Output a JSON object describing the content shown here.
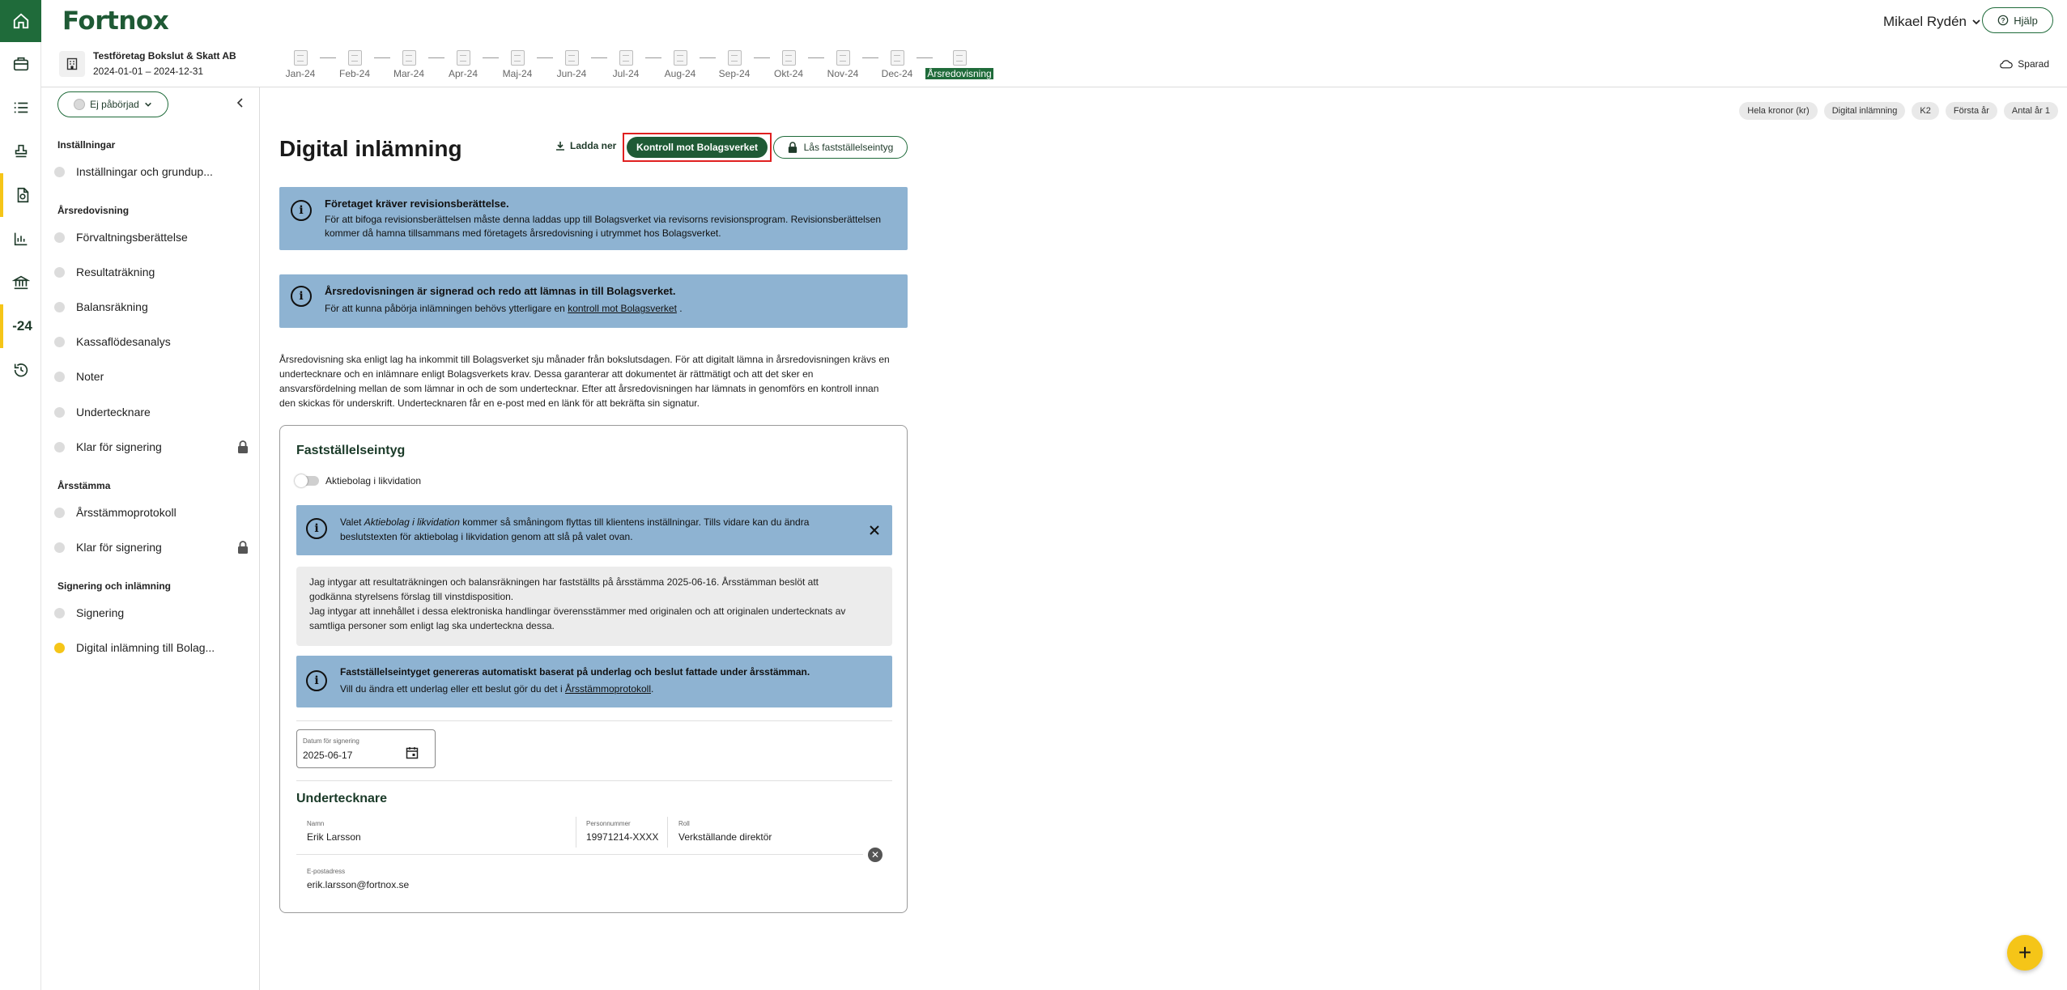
{
  "app": {
    "logo": "Fortnox",
    "user_name": "Mikael Rydén",
    "help_label": "Hjälp",
    "rail_year_label": "-24"
  },
  "company": {
    "name": "Testföretag Bokslut & Skatt AB",
    "period": "2024-01-01 – 2024-12-31"
  },
  "timeline": [
    "Jan-24",
    "Feb-24",
    "Mar-24",
    "Apr-24",
    "Maj-24",
    "Jun-24",
    "Jul-24",
    "Aug-24",
    "Sep-24",
    "Okt-24",
    "Nov-24",
    "Dec-24",
    "Årsredovisning"
  ],
  "saved_label": "Sparad",
  "sidebar": {
    "status_label": "Ej påbörjad",
    "sections": {
      "installningar": "Inställningar",
      "arsredovisning": "Årsredovisning",
      "arsstamma": "Årsstämma",
      "signering": "Signering och inlämning"
    },
    "items": [
      "Inställningar och grundup...",
      "Förvaltningsberättelse",
      "Resultaträkning",
      "Balansräkning",
      "Kassaflödesanalys",
      "Noter",
      "Undertecknare",
      "Klar för signering",
      "Årsstämmoprotokoll",
      "Klar för signering",
      "Signering",
      "Digital inlämning till Bolag..."
    ]
  },
  "tags": [
    "Hela kronor (kr)",
    "Digital inlämning",
    "K2",
    "Första år",
    "Antal år 1"
  ],
  "main": {
    "title": "Digital inlämning",
    "download_label": "Ladda ner",
    "kontroll_label": "Kontroll mot Bolagsverket",
    "las_label": "Lås fastställelseintyg",
    "info1_title": "Företaget kräver revisionsberättelse.",
    "info1_line1": "För att bifoga revisionsberättelsen måste denna laddas upp till Bolagsverket via revisorns revisionsprogram. Revisionsberättelsen",
    "info1_line2": "kommer då hamna tillsammans med företagets årsredovisning i utrymmet hos Bolagsverket.",
    "info2_title": "Årsredovisningen är signerad och redo att lämnas in till Bolagsverket.",
    "info2_text": "För att kunna påbörja inlämningen behövs ytterligare en",
    "info2_link": "kontroll mot Bolagsverket",
    "info2_end": ".",
    "para_line1": "Årsredovisning ska enligt lag ha inkommit till Bolagsverket sju månader från bokslutsdagen. För att digitalt lämna in årsredovisningen krävs en",
    "para_line2": "undertecknare och en inlämnare enligt Bolagsverkets krav. Dessa garanterar att dokumentet är rättmätigt och att det sker en",
    "para_line3": "ansvarsfördelning mellan de som lämnar in och de som undertecknar. Efter att årsredovisningen har lämnats in genomförs en kontroll innan",
    "para_line4": "den skickas för underskrift. Undertecknaren får en e-post med en länk för att bekräfta sin signatur."
  },
  "card": {
    "title": "Fastställelseintyg",
    "toggle_label": "Aktiebolag i likvidation",
    "notice_pre": "Valet ",
    "notice_em": "Aktiebolag i likvidation",
    "notice_post": " kommer så småningom flyttas till klientens inställningar. Tills vidare kan du ändra",
    "notice_line2": "beslutstexten för aktiebolag i likvidation genom att slå på valet ovan.",
    "intyg_line1": "Jag intygar att resultaträkningen och balansräkningen har fastställts på årsstämma 2025-06-16. Årsstämman beslöt att",
    "intyg_line2": "godkänna styrelsens förslag till vinstdisposition.",
    "intyg_line3": "Jag intygar att innehållet i dessa elektroniska handlingar överensstämmer med originalen och att originalen undertecknats av",
    "intyg_line4": "samtliga personer som enligt lag ska underteckna dessa.",
    "auto_title": "Fastställelseintyget genereras automatiskt baserat på underlag och beslut fattade under årsstämman.",
    "auto_text": "Vill du ändra ett underlag eller ett beslut gör du det i",
    "auto_link": "Årsstämmoprotokoll",
    "auto_end": ".",
    "date_label": "Datum för signering",
    "date_value": "2025-06-17",
    "signers_title": "Undertecknare",
    "name_label": "Namn",
    "name_value": "Erik Larsson",
    "pnr_label": "Personnummer",
    "pnr_value": "19971214-XXXX",
    "role_label": "Roll",
    "role_value": "Verkställande direktör",
    "email_label": "E-postadress",
    "email_value": "erik.larsson@fortnox.se"
  },
  "colors": {
    "brand_green": "#1f6b3a",
    "dark_green": "#1f5a35",
    "info_blue": "#8eb3d2",
    "accent_yellow": "#f5c518",
    "highlight_red": "#e02020"
  }
}
